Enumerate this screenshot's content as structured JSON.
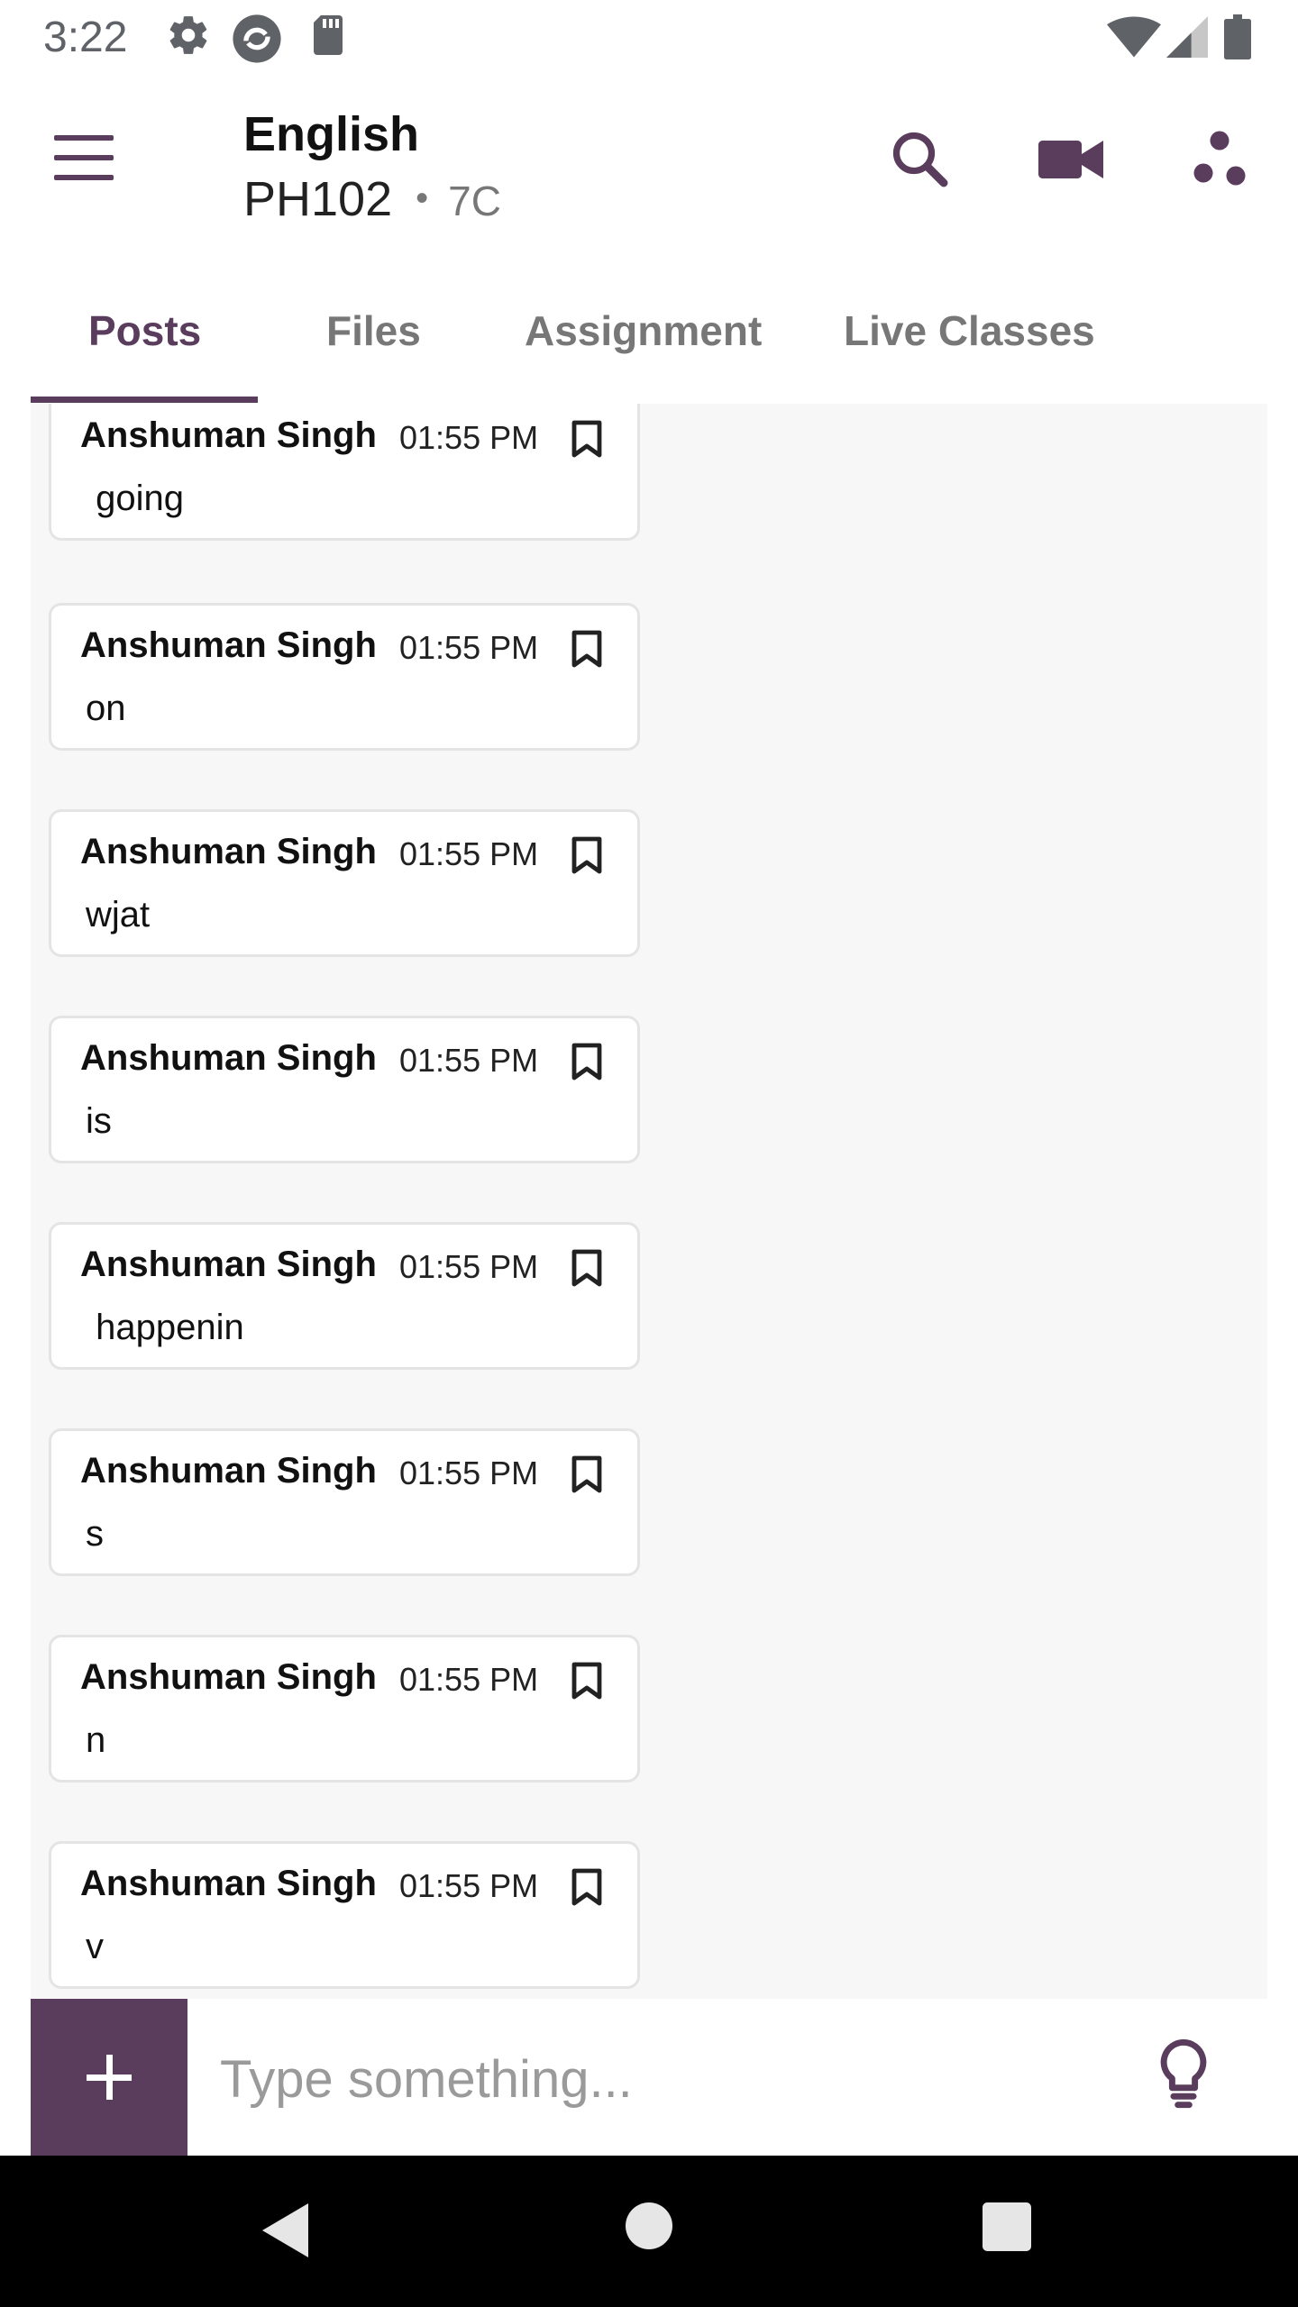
{
  "status_bar": {
    "time": "3:22",
    "icons": [
      "settings-icon",
      "sync-icon",
      "sd-card-icon",
      "wifi-icon",
      "signal-icon",
      "battery-icon"
    ]
  },
  "app_bar": {
    "title": "English",
    "subtitle": "PH102",
    "section": "7C",
    "icons": [
      "menu-icon",
      "search-icon",
      "video-camera-icon",
      "share-icon"
    ]
  },
  "tabs": [
    {
      "label": "Posts",
      "active": true
    },
    {
      "label": "Files",
      "active": false
    },
    {
      "label": "Assignment",
      "active": false
    },
    {
      "label": "Live Classes",
      "active": false
    }
  ],
  "posts": [
    {
      "author": "Anshuman Singh",
      "time": "01:55 PM",
      "message": " going"
    },
    {
      "author": "Anshuman Singh",
      "time": "01:55 PM",
      "message": "on"
    },
    {
      "author": "Anshuman Singh",
      "time": "01:55 PM",
      "message": "wjat"
    },
    {
      "author": "Anshuman Singh",
      "time": "01:55 PM",
      "message": "is"
    },
    {
      "author": "Anshuman Singh",
      "time": "01:55 PM",
      "message": " happenin"
    },
    {
      "author": "Anshuman Singh",
      "time": "01:55 PM",
      "message": "s"
    },
    {
      "author": "Anshuman Singh",
      "time": "01:55 PM",
      "message": "n"
    },
    {
      "author": "Anshuman Singh",
      "time": "01:55 PM",
      "message": "v"
    }
  ],
  "composer": {
    "placeholder": "Type something...",
    "value": ""
  },
  "colors": {
    "primary": "#5a3d5c",
    "feed_background": "#f7f7f7",
    "nav_background": "#000000"
  }
}
